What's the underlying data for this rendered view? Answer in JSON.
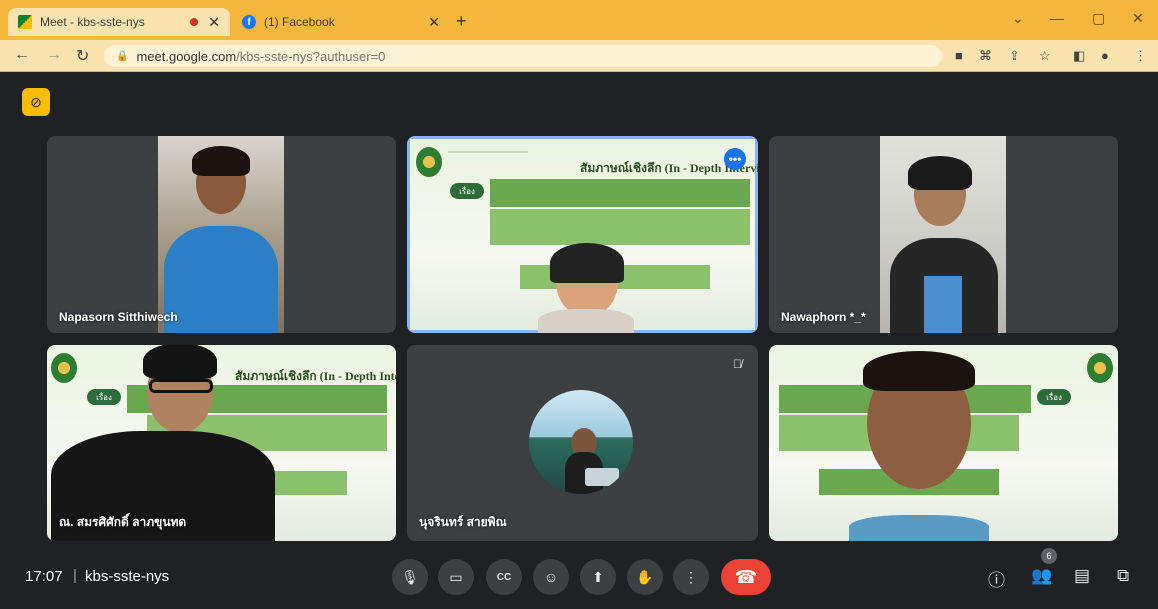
{
  "browser": {
    "tabs": [
      {
        "title": "Meet - kbs-sste-nys",
        "favicon": "meet-icon"
      },
      {
        "title": "(1) Facebook",
        "favicon": "facebook-icon"
      }
    ],
    "url": "meet.google.com/kbs-sste-nys?authuser=0",
    "url_host": "meet.google.com",
    "url_rest": "/kbs-sste-nys?authuser=0"
  },
  "meeting": {
    "time": "17:07",
    "code": "kbs-sste-nys",
    "participant_count": "6"
  },
  "participants": [
    {
      "name": "Napasorn Sitthiwech"
    },
    {
      "name": ""
    },
    {
      "name": "Nawaphorn *_*"
    },
    {
      "name": "ณ. สมรศิศักดิ์ ลาภขุนทด"
    },
    {
      "name": "นุจรินทร์ สายพิณ"
    },
    {
      "name": ""
    }
  ],
  "slide": {
    "title": "สัมภาษณ์เชิงลึก (In - Depth Interview)",
    "pill": "เรื่อง"
  },
  "colors": {
    "chrome": "#f6b73c",
    "meet_bg": "#202124",
    "end_call": "#ea4335",
    "speaking_outline": "#8ab4f8"
  }
}
